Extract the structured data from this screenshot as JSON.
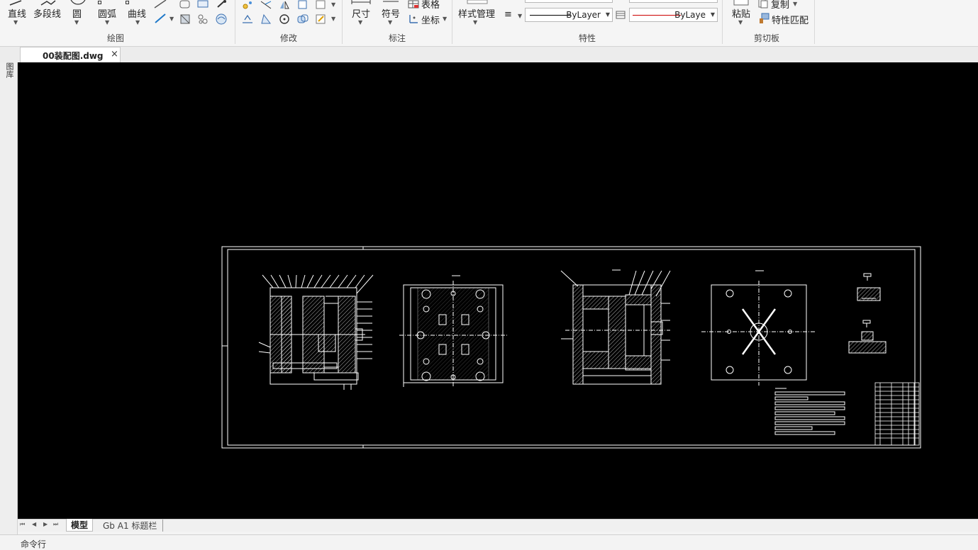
{
  "ribbon": {
    "draw": {
      "label": "绘图",
      "line": "直线",
      "polyline": "多段线",
      "circle": "圆",
      "arc": "圆弧",
      "curve": "曲线"
    },
    "modify": {
      "label": "修改"
    },
    "annotate": {
      "label": "标注",
      "dimension": "尺寸",
      "symbol": "符号",
      "table": "表格",
      "coordinate": "坐标"
    },
    "properties": {
      "label": "特性",
      "style_manager": "样式管理",
      "linetype_value": "ByLayer",
      "color_value": "ByLaye",
      "accent_color": "#cc0000"
    },
    "clipboard": {
      "label": "剪切板",
      "paste": "粘贴",
      "copy": "复制",
      "match_properties": "特性匹配"
    }
  },
  "document_tab": {
    "title": "00装配图.dwg",
    "close": "×"
  },
  "left_panel": {
    "label": "图库"
  },
  "layout_tabs": {
    "nav": [
      "⏮",
      "◀",
      "▶",
      "⏭"
    ],
    "model": "模型",
    "layout1": "Gb A1 标题栏"
  },
  "command_line": {
    "label": "命令行"
  }
}
